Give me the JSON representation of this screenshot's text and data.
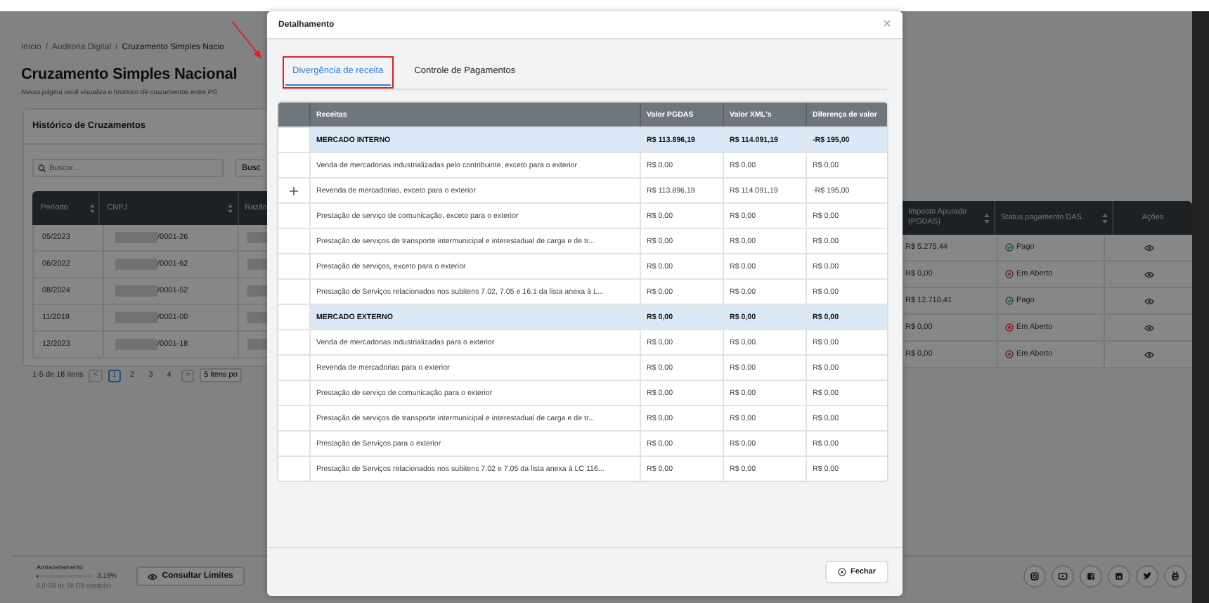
{
  "breadcrumb": [
    "Início",
    "Auditoria Digital",
    "Cruzamento Simples Nacio"
  ],
  "breadcrumb_separator": "/",
  "page_title": "Cruzamento Simples Nacional",
  "page_subtitle": "Nessa página você visualiza o histórico de cruzamentos entre PG",
  "history": {
    "title": "Histórico de Cruzamentos",
    "search_placeholder": "Buscar...",
    "search_button": "Busc",
    "columns_left": [
      "Período",
      "CNPJ",
      "Razão"
    ],
    "columns_right": [
      "Imposto Apurado (PGDAS)",
      "Status pagamento DAS",
      "Ações"
    ],
    "rows": [
      {
        "period": "05/2023",
        "cnpj": "/0001-26",
        "tax": "R$ 5.275,44",
        "status": "Pago",
        "kind": "paid"
      },
      {
        "period": "06/2022",
        "cnpj": "/0001-62",
        "tax": "R$ 0,00",
        "status": "Em Aberto",
        "kind": "open"
      },
      {
        "period": "08/2024",
        "cnpj": "/0001-52",
        "tax": "R$ 12.710,41",
        "status": "Pago",
        "kind": "paid"
      },
      {
        "period": "11/2019",
        "cnpj": "/0001-00",
        "tax": "R$ 0,00",
        "status": "Em Aberto",
        "kind": "open"
      },
      {
        "period": "12/2023",
        "cnpj": "/0001-18",
        "tax": "R$ 0,00",
        "status": "Em Aberto",
        "kind": "open"
      }
    ],
    "pagination": {
      "summary": "1-5 de 18 itens",
      "prev": "<",
      "next": ">",
      "pages": [
        {
          "label": "1",
          "selected": true
        },
        {
          "label": "2",
          "selected": false
        },
        {
          "label": "3",
          "selected": false
        },
        {
          "label": "4",
          "selected": false
        }
      ],
      "page_size": "5 itens po"
    }
  },
  "storage": {
    "label": "Armazenamento",
    "percent": "3,19%",
    "level": 0.0319,
    "usage": "2,0 GB de 58 GB usado(s)",
    "button": "Consultar Limites"
  },
  "modal": {
    "title": "Detalhamento",
    "close": "×",
    "tabs": [
      {
        "label": "Divergência de receita",
        "selected": true,
        "annotated": true
      },
      {
        "label": "Controle de Pagamentos",
        "selected": false,
        "annotated": false
      }
    ],
    "columns": [
      "Receitas",
      "Valor PGDAS",
      "Valor XML's",
      "Diferença de valor"
    ],
    "rows": [
      {
        "kind": "group",
        "expandable": false,
        "name": "MERCADO INTERNO",
        "pgdas": "R$ 113.896,19",
        "xml": "R$ 114.091,19",
        "diff": "-R$ 195,00"
      },
      {
        "kind": "item",
        "expandable": false,
        "name": "Venda de mercadorias industrializadas pelo contribuinte, exceto para o exterior",
        "pgdas": "R$ 0,00",
        "xml": "R$ 0,00",
        "diff": "R$ 0,00"
      },
      {
        "kind": "item",
        "expandable": true,
        "name": "Revenda de mercadorias, exceto para o exterior",
        "pgdas": "R$ 113.896,19",
        "xml": "R$ 114.091,19",
        "diff": "-R$ 195,00"
      },
      {
        "kind": "item",
        "expandable": false,
        "name": "Prestação de serviço de comunicação, exceto para o exterior",
        "pgdas": "R$ 0,00",
        "xml": "R$ 0,00",
        "diff": "R$ 0,00"
      },
      {
        "kind": "item",
        "expandable": false,
        "name": "Prestação de serviços de transporte intermunicipal e interestadual de carga e de tr...",
        "pgdas": "R$ 0,00",
        "xml": "R$ 0,00",
        "diff": "R$ 0,00"
      },
      {
        "kind": "item",
        "expandable": false,
        "name": "Prestação de serviços, exceto para o exterior",
        "pgdas": "R$ 0,00",
        "xml": "R$ 0,00",
        "diff": "R$ 0,00"
      },
      {
        "kind": "item",
        "expandable": false,
        "name": "Prestação de Serviços relacionados nos subitens 7.02, 7.05 e 16.1 da lista anexa à L...",
        "pgdas": "R$ 0,00",
        "xml": "R$ 0,00",
        "diff": "R$ 0,00"
      },
      {
        "kind": "group",
        "expandable": false,
        "name": "MERCADO EXTERNO",
        "pgdas": "R$ 0,00",
        "xml": "R$ 0,00",
        "diff": "R$ 0,00"
      },
      {
        "kind": "item",
        "expandable": false,
        "name": "Venda de mercadorias industrializadas para o exterior",
        "pgdas": "R$ 0,00",
        "xml": "R$ 0,00",
        "diff": "R$ 0,00"
      },
      {
        "kind": "item",
        "expandable": false,
        "name": "Revenda de mercadorias para o exterior",
        "pgdas": "R$ 0,00",
        "xml": "R$ 0,00",
        "diff": "R$ 0,00"
      },
      {
        "kind": "item",
        "expandable": false,
        "name": "Prestação de serviço de comunicação para o exterior",
        "pgdas": "R$ 0,00",
        "xml": "R$ 0,00",
        "diff": "R$ 0,00"
      },
      {
        "kind": "item",
        "expandable": false,
        "name": "Prestação de serviços de transporte intermunicipal e interestadual de carga e de tr...",
        "pgdas": "R$ 0,00",
        "xml": "R$ 0,00",
        "diff": "R$ 0,00"
      },
      {
        "kind": "item",
        "expandable": false,
        "name": "Prestação de Serviços para o exterior",
        "pgdas": "R$ 0,00",
        "xml": "R$ 0,00",
        "diff": "R$ 0,00"
      },
      {
        "kind": "item",
        "expandable": false,
        "name": "Prestação de Serviços relacionados nos subitens 7.02 e 7.05 da lista anexa à LC 116...",
        "pgdas": "R$ 0,00",
        "xml": "R$ 0,00",
        "diff": "R$ 0,00"
      }
    ],
    "close_button": "Fechar"
  }
}
